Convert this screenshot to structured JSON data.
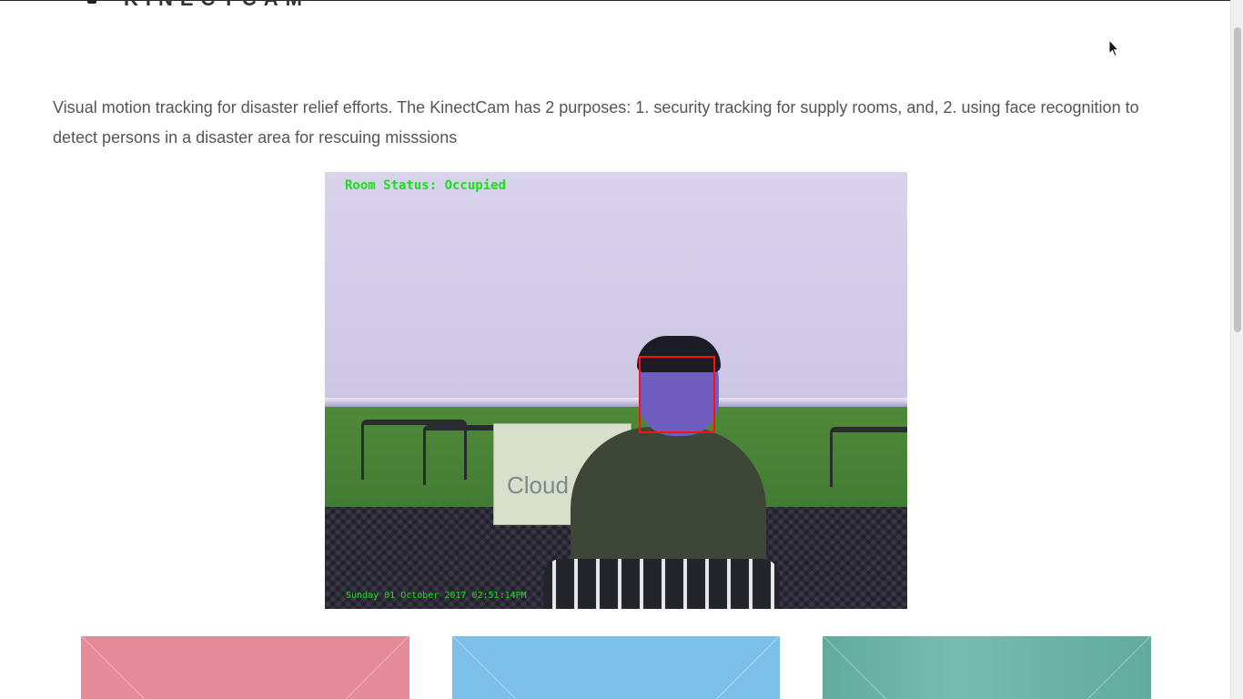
{
  "header": {
    "title": "KINECTCAM"
  },
  "project": {
    "description": "Visual motion tracking for disaster relief efforts. The KinectCam has 2 purposes: 1. security tracking for supply rooms, and, 2. using face recognition to detect persons in a disaster area for rescuing misssions"
  },
  "camera_feed": {
    "status_overlay": "Room Status: Occupied",
    "timestamp_overlay": "Sunday 01 October 2017 02:51:14PM",
    "banner_text": "Cloud"
  },
  "colors": {
    "card_pink": "#e68b9a",
    "card_blue": "#7cc0ea",
    "card_green": "#6db3a5",
    "overlay_text": "#18e018",
    "face_box": "#ff1010"
  },
  "icons": {
    "heading": "square-bullet-icon",
    "cursor": "arrow-cursor-icon"
  }
}
